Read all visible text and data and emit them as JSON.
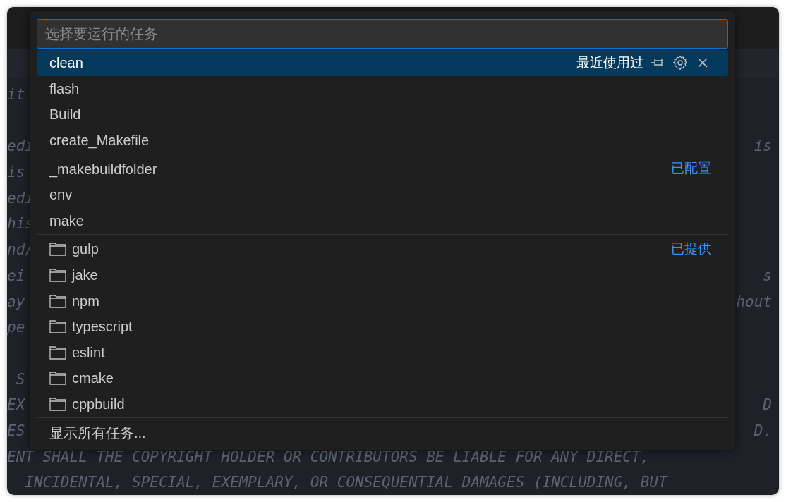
{
  "editor": {
    "lines": [
      {
        "left": "it"
      },
      {
        "left": "edi",
        "right": "is",
        "blank_before": true
      },
      {
        "left": "is"
      },
      {
        "left": "edi"
      },
      {
        "left": "his"
      },
      {
        "left": "nd/"
      },
      {
        "left": "ei",
        "right": "s"
      },
      {
        "left": "ay",
        "right": "hout"
      },
      {
        "left": "pe"
      },
      {
        "left": " S",
        "blank_before": true
      },
      {
        "left": "EX",
        "right": "D"
      },
      {
        "left": "ES",
        "right": "D."
      },
      {
        "left": "ENT SHALL THE COPYRIGHT HOLDER OR CONTRIBUTORS BE LIABLE FOR ANY DIRECT,"
      },
      {
        "left": "  INCIDENTAL, SPECIAL, EXEMPLARY, OR CONSEQUENTIAL DAMAGES (INCLUDING, BUT"
      }
    ]
  },
  "quick_pick": {
    "placeholder": "选择要运行的任务",
    "groups": [
      {
        "items": [
          {
            "label": "clean",
            "kind": "task",
            "selected": true,
            "badge": "最近使用过"
          },
          {
            "label": "flash",
            "kind": "task",
            "selected": false
          },
          {
            "label": "Build",
            "kind": "task",
            "selected": false
          },
          {
            "label": "create_Makefile",
            "kind": "task",
            "selected": false
          }
        ]
      },
      {
        "items": [
          {
            "label": "_makebuildfolder",
            "kind": "task",
            "selected": false,
            "badge": "已配置"
          },
          {
            "label": "env",
            "kind": "task",
            "selected": false
          },
          {
            "label": "make",
            "kind": "task",
            "selected": false
          }
        ]
      },
      {
        "items": [
          {
            "label": "gulp",
            "kind": "folder",
            "selected": false,
            "badge": "已提供"
          },
          {
            "label": "jake",
            "kind": "folder",
            "selected": false
          },
          {
            "label": "npm",
            "kind": "folder",
            "selected": false
          },
          {
            "label": "typescript",
            "kind": "folder",
            "selected": false
          },
          {
            "label": "eslint",
            "kind": "folder",
            "selected": false
          },
          {
            "label": "cmake",
            "kind": "folder",
            "selected": false
          },
          {
            "label": "cppbuild",
            "kind": "folder",
            "selected": false
          }
        ]
      },
      {
        "items": [
          {
            "label": "显示所有任务...",
            "kind": "task",
            "selected": false
          }
        ]
      }
    ]
  }
}
